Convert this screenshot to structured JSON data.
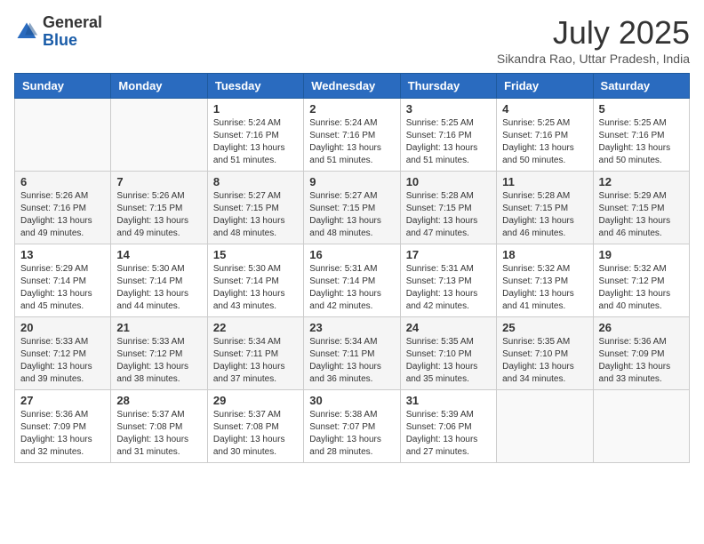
{
  "header": {
    "logo_general": "General",
    "logo_blue": "Blue",
    "month_title": "July 2025",
    "subtitle": "Sikandra Rao, Uttar Pradesh, India"
  },
  "weekdays": [
    "Sunday",
    "Monday",
    "Tuesday",
    "Wednesday",
    "Thursday",
    "Friday",
    "Saturday"
  ],
  "weeks": [
    [
      {
        "day": "",
        "info": ""
      },
      {
        "day": "",
        "info": ""
      },
      {
        "day": "1",
        "info": "Sunrise: 5:24 AM\nSunset: 7:16 PM\nDaylight: 13 hours and 51 minutes."
      },
      {
        "day": "2",
        "info": "Sunrise: 5:24 AM\nSunset: 7:16 PM\nDaylight: 13 hours and 51 minutes."
      },
      {
        "day": "3",
        "info": "Sunrise: 5:25 AM\nSunset: 7:16 PM\nDaylight: 13 hours and 51 minutes."
      },
      {
        "day": "4",
        "info": "Sunrise: 5:25 AM\nSunset: 7:16 PM\nDaylight: 13 hours and 50 minutes."
      },
      {
        "day": "5",
        "info": "Sunrise: 5:25 AM\nSunset: 7:16 PM\nDaylight: 13 hours and 50 minutes."
      }
    ],
    [
      {
        "day": "6",
        "info": "Sunrise: 5:26 AM\nSunset: 7:16 PM\nDaylight: 13 hours and 49 minutes."
      },
      {
        "day": "7",
        "info": "Sunrise: 5:26 AM\nSunset: 7:15 PM\nDaylight: 13 hours and 49 minutes."
      },
      {
        "day": "8",
        "info": "Sunrise: 5:27 AM\nSunset: 7:15 PM\nDaylight: 13 hours and 48 minutes."
      },
      {
        "day": "9",
        "info": "Sunrise: 5:27 AM\nSunset: 7:15 PM\nDaylight: 13 hours and 48 minutes."
      },
      {
        "day": "10",
        "info": "Sunrise: 5:28 AM\nSunset: 7:15 PM\nDaylight: 13 hours and 47 minutes."
      },
      {
        "day": "11",
        "info": "Sunrise: 5:28 AM\nSunset: 7:15 PM\nDaylight: 13 hours and 46 minutes."
      },
      {
        "day": "12",
        "info": "Sunrise: 5:29 AM\nSunset: 7:15 PM\nDaylight: 13 hours and 46 minutes."
      }
    ],
    [
      {
        "day": "13",
        "info": "Sunrise: 5:29 AM\nSunset: 7:14 PM\nDaylight: 13 hours and 45 minutes."
      },
      {
        "day": "14",
        "info": "Sunrise: 5:30 AM\nSunset: 7:14 PM\nDaylight: 13 hours and 44 minutes."
      },
      {
        "day": "15",
        "info": "Sunrise: 5:30 AM\nSunset: 7:14 PM\nDaylight: 13 hours and 43 minutes."
      },
      {
        "day": "16",
        "info": "Sunrise: 5:31 AM\nSunset: 7:14 PM\nDaylight: 13 hours and 42 minutes."
      },
      {
        "day": "17",
        "info": "Sunrise: 5:31 AM\nSunset: 7:13 PM\nDaylight: 13 hours and 42 minutes."
      },
      {
        "day": "18",
        "info": "Sunrise: 5:32 AM\nSunset: 7:13 PM\nDaylight: 13 hours and 41 minutes."
      },
      {
        "day": "19",
        "info": "Sunrise: 5:32 AM\nSunset: 7:12 PM\nDaylight: 13 hours and 40 minutes."
      }
    ],
    [
      {
        "day": "20",
        "info": "Sunrise: 5:33 AM\nSunset: 7:12 PM\nDaylight: 13 hours and 39 minutes."
      },
      {
        "day": "21",
        "info": "Sunrise: 5:33 AM\nSunset: 7:12 PM\nDaylight: 13 hours and 38 minutes."
      },
      {
        "day": "22",
        "info": "Sunrise: 5:34 AM\nSunset: 7:11 PM\nDaylight: 13 hours and 37 minutes."
      },
      {
        "day": "23",
        "info": "Sunrise: 5:34 AM\nSunset: 7:11 PM\nDaylight: 13 hours and 36 minutes."
      },
      {
        "day": "24",
        "info": "Sunrise: 5:35 AM\nSunset: 7:10 PM\nDaylight: 13 hours and 35 minutes."
      },
      {
        "day": "25",
        "info": "Sunrise: 5:35 AM\nSunset: 7:10 PM\nDaylight: 13 hours and 34 minutes."
      },
      {
        "day": "26",
        "info": "Sunrise: 5:36 AM\nSunset: 7:09 PM\nDaylight: 13 hours and 33 minutes."
      }
    ],
    [
      {
        "day": "27",
        "info": "Sunrise: 5:36 AM\nSunset: 7:09 PM\nDaylight: 13 hours and 32 minutes."
      },
      {
        "day": "28",
        "info": "Sunrise: 5:37 AM\nSunset: 7:08 PM\nDaylight: 13 hours and 31 minutes."
      },
      {
        "day": "29",
        "info": "Sunrise: 5:37 AM\nSunset: 7:08 PM\nDaylight: 13 hours and 30 minutes."
      },
      {
        "day": "30",
        "info": "Sunrise: 5:38 AM\nSunset: 7:07 PM\nDaylight: 13 hours and 28 minutes."
      },
      {
        "day": "31",
        "info": "Sunrise: 5:39 AM\nSunset: 7:06 PM\nDaylight: 13 hours and 27 minutes."
      },
      {
        "day": "",
        "info": ""
      },
      {
        "day": "",
        "info": ""
      }
    ]
  ]
}
